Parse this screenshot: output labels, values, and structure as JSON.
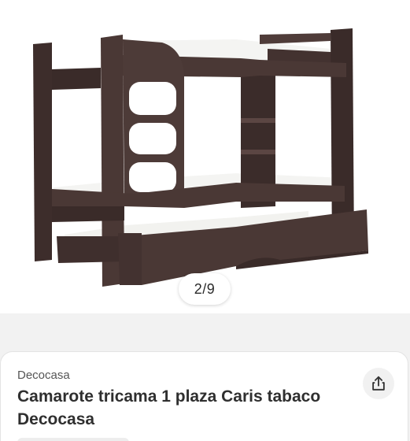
{
  "gallery": {
    "counter": "2/9"
  },
  "product": {
    "brand": "Decocasa",
    "title": "Camarote tricama 1 plaza Caris tabaco Decocasa"
  },
  "icons": {
    "share": "share-icon"
  },
  "colors": {
    "wood": "#4a3835",
    "wood_dark": "#3a2b29",
    "mattress": "#f4f4f2",
    "background": "#f2f2f2"
  }
}
